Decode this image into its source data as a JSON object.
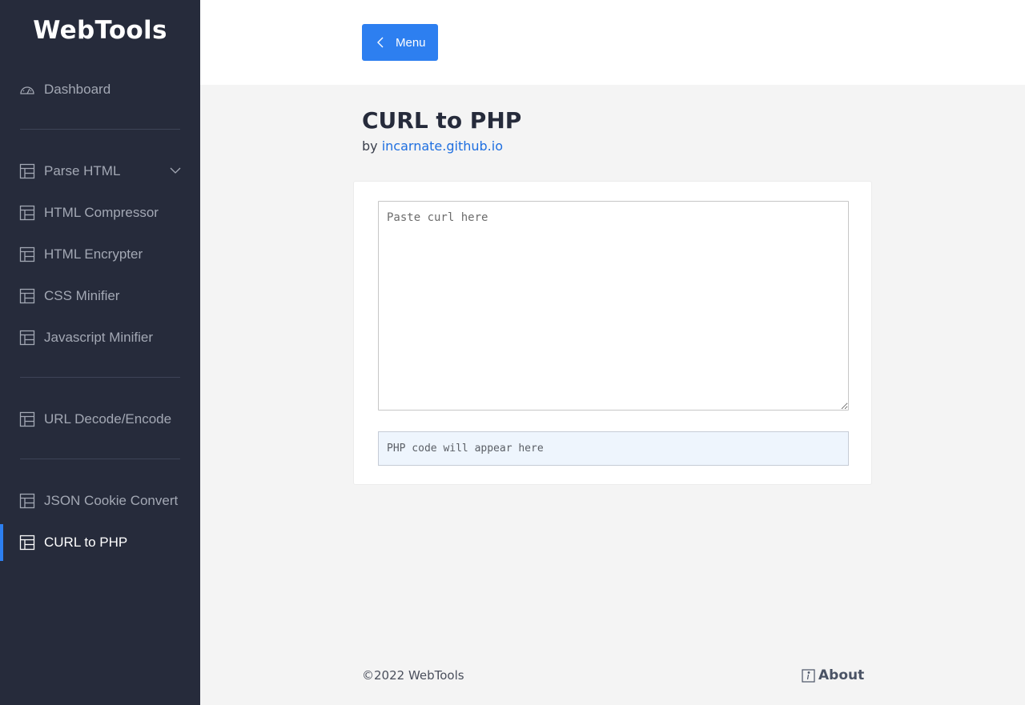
{
  "sidebar": {
    "brand": "WebTools",
    "items": [
      {
        "label": "Dashboard",
        "icon": "dashboard-icon"
      },
      {
        "label": "Parse HTML",
        "icon": "table-icon",
        "expandable": true
      },
      {
        "label": "HTML Compressor",
        "icon": "table-icon"
      },
      {
        "label": "HTML Encrypter",
        "icon": "table-icon"
      },
      {
        "label": "CSS Minifier",
        "icon": "table-icon"
      },
      {
        "label": "Javascript Minifier",
        "icon": "table-icon"
      },
      {
        "label": "URL Decode/Encode",
        "icon": "table-icon"
      },
      {
        "label": "JSON Cookie Convert",
        "icon": "table-icon"
      },
      {
        "label": "CURL to PHP",
        "icon": "table-icon",
        "active": true
      }
    ]
  },
  "header": {
    "menu_label": "Menu"
  },
  "main": {
    "title": "CURL to PHP",
    "by_prefix": "by",
    "by_link": "incarnate.github.io",
    "curl_placeholder": "Paste curl here",
    "output_placeholder": "PHP code will appear here"
  },
  "footer": {
    "copyright": "©2022 WebTools",
    "about": "About"
  },
  "colors": {
    "sidebar_bg": "#262b3b",
    "accent": "#2d7ff0",
    "link": "#1f6fe0",
    "page_bg": "#f4f4f4"
  }
}
